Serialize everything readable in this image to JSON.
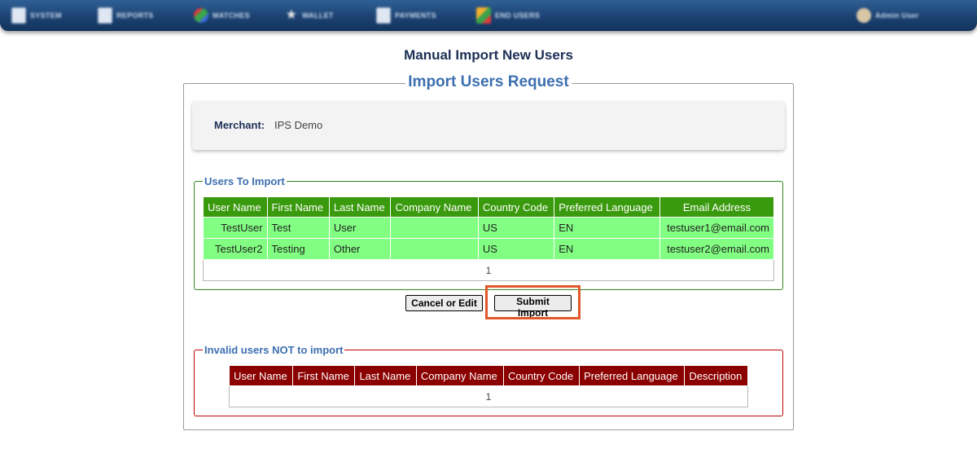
{
  "nav": {
    "items": [
      {
        "label": "SYSTEM",
        "icon": "document-icon"
      },
      {
        "label": "REPORTS",
        "icon": "document-icon"
      },
      {
        "label": "MATCHES",
        "icon": "gem-icon"
      },
      {
        "label": "WALLET",
        "icon": "star-icon"
      },
      {
        "label": "PAYMENTS",
        "icon": "document-icon"
      },
      {
        "label": "END USERS",
        "icon": "chart-icon"
      }
    ],
    "user_label": "Admin User"
  },
  "page_title": "Manual Import New Users",
  "section_title": "Import Users Request",
  "merchant": {
    "label": "Merchant:",
    "value": "IPS Demo"
  },
  "users_to_import": {
    "legend": "Users To Import",
    "columns": [
      "User Name",
      "First Name",
      "Last Name",
      "Company Name",
      "Country Code",
      "Preferred Language",
      "Email Address"
    ],
    "rows": [
      [
        "TestUser",
        "Test",
        "User",
        "",
        "US",
        "EN",
        "testuser1@email.com"
      ],
      [
        "TestUser2",
        "Testing",
        "Other",
        "",
        "US",
        "EN",
        "testuser2@email.com"
      ]
    ],
    "pager": "1"
  },
  "buttons": {
    "cancel": "Cancel or Edit",
    "submit": "Submit Import"
  },
  "invalid_users": {
    "legend": "Invalid users NOT to import",
    "columns": [
      "User Name",
      "First Name",
      "Last Name",
      "Company Name",
      "Country Code",
      "Preferred Language",
      "Description"
    ],
    "pager": "1"
  },
  "colors": {
    "import_header": "#3a9a0d",
    "import_row": "#82ff82",
    "invalid_header": "#8b0000",
    "highlight": "#e0582a"
  }
}
